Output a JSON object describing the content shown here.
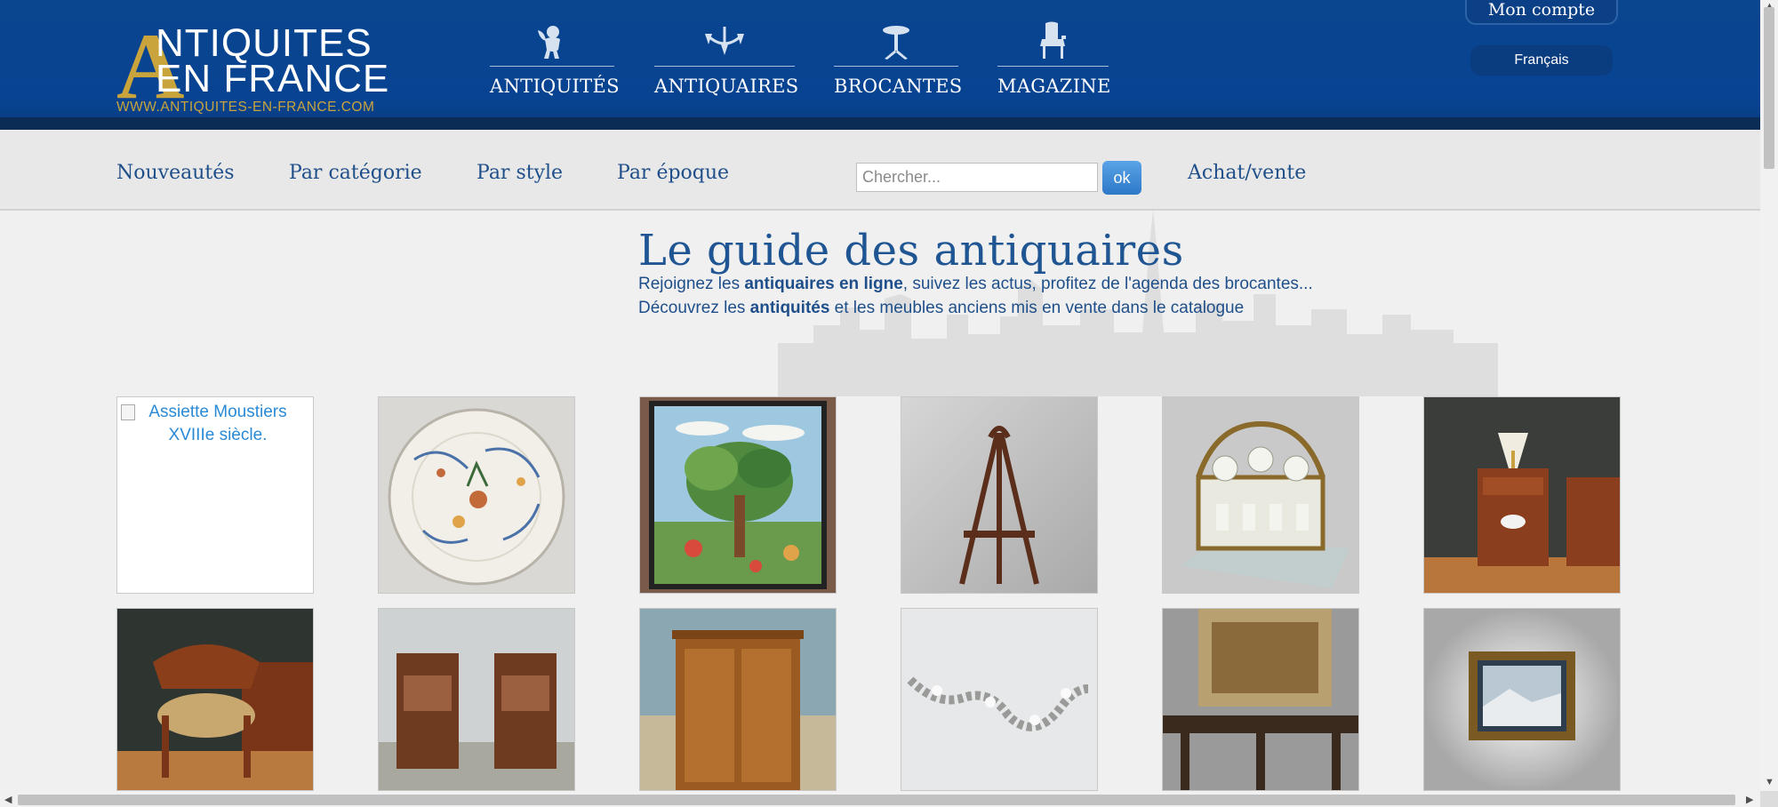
{
  "logo": {
    "letter": "A",
    "line1": "NTIQUITES",
    "line2": "EN FRANCE",
    "url": "WWW.ANTIQUITES-EN-FRANCE.COM"
  },
  "main_nav": [
    {
      "label": "ANTIQUITÉS",
      "icon": "cherub-icon"
    },
    {
      "label": "ANTIQUAIRES",
      "icon": "chandelier-icon"
    },
    {
      "label": "BROCANTES",
      "icon": "pedestal-table-icon"
    },
    {
      "label": "MAGAZINE",
      "icon": "armchair-icon"
    }
  ],
  "account": {
    "label": "Mon compte"
  },
  "language": {
    "label": "Français"
  },
  "sub_nav": {
    "links": [
      "Nouveautés",
      "Par catégorie",
      "Par style",
      "Par époque"
    ],
    "achat": "Achat/vente"
  },
  "search": {
    "placeholder": "Chercher...",
    "value": "",
    "button": "ok"
  },
  "headline": "Le guide des antiquaires",
  "intro": {
    "line1_pre": "Rejoignez les ",
    "line1_bold": "antiquaires en ligne",
    "line1_post": ", suivez les actus, profitez de l'agenda des brocantes...",
    "line2_pre": "Découvrez les ",
    "line2_bold": "antiquités",
    "line2_post": " et les meubles anciens mis en vente dans le catalogue"
  },
  "products": [
    {
      "alt": "Assiette Moustiers XVIIIe siècle.",
      "broken": true
    },
    {
      "subject": "faience-plate"
    },
    {
      "subject": "tapestry-tree"
    },
    {
      "subject": "easel"
    },
    {
      "subject": "liquor-cabinet"
    },
    {
      "subject": "bedside-table-lamp"
    },
    {
      "subject": "office-armchair"
    },
    {
      "subject": "pair-nightstands"
    },
    {
      "subject": "wooden-cabinet"
    },
    {
      "subject": "bracelet"
    },
    {
      "subject": "long-table-tapestry"
    },
    {
      "subject": "framed-painting"
    }
  ],
  "colors": {
    "header_blue": "#074391",
    "gold": "#c9a43c",
    "link_blue": "#1f4f8a",
    "ok_button": "#2d78c8"
  }
}
